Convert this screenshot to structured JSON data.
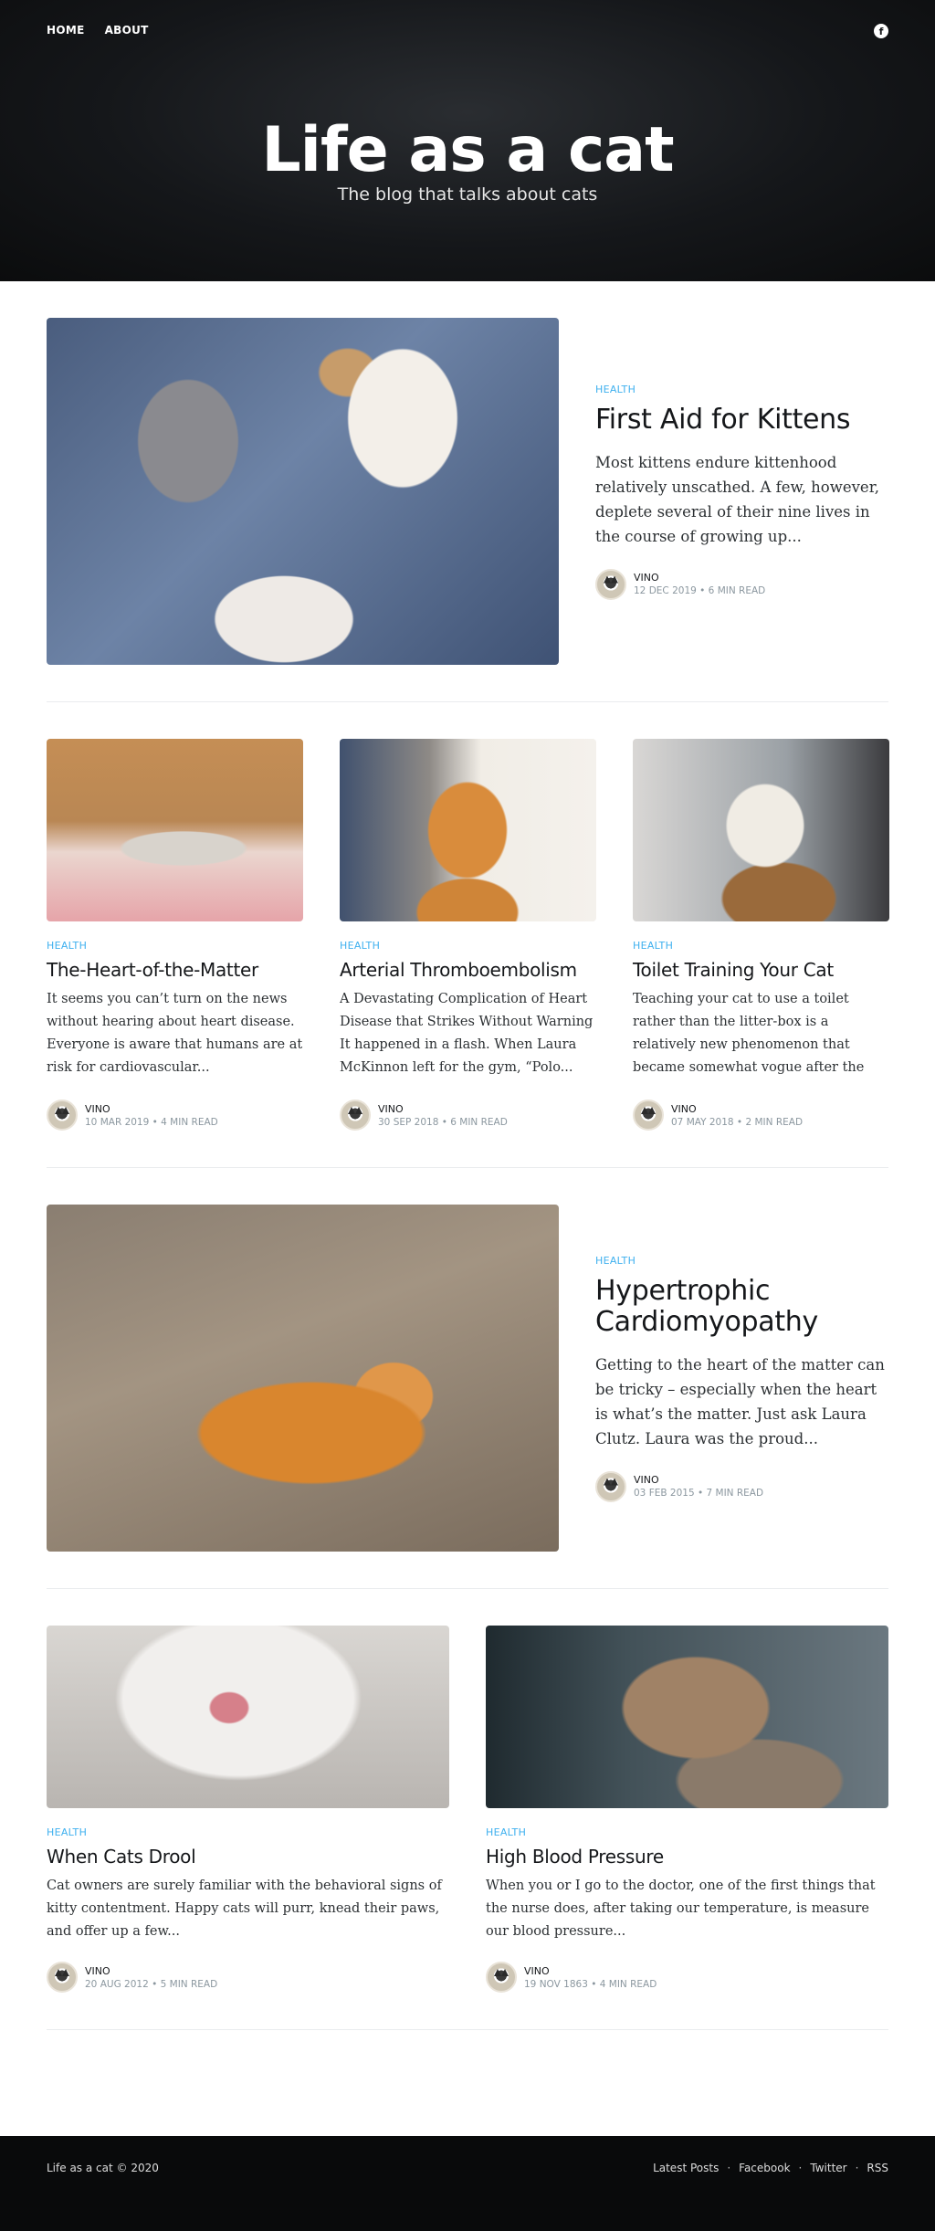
{
  "nav": {
    "home": "Home",
    "about": "About"
  },
  "site": {
    "title": "Life as a cat",
    "description": "The blog that talks about cats"
  },
  "posts": [
    {
      "tag": "Health",
      "title": "First Aid for Kittens",
      "excerpt": "Most kittens endure kittenhood relatively unscathed. A few, however, deplete several of their nine lives in the course of growing up...",
      "author": "Vino",
      "meta": "12 Dec 2019 • 6 min read"
    },
    {
      "tag": "Health",
      "title": "The-Heart-of-the-Matter",
      "excerpt": "It seems you can’t turn on the news without hearing about heart disease. Everyone is aware that humans are at risk for cardiovascular...",
      "author": "Vino",
      "meta": "10 Mar 2019 • 4 min read"
    },
    {
      "tag": "Health",
      "title": "Arterial Thromboembolism",
      "excerpt": "A Devastating Complication of Heart Disease that Strikes Without Warning It happened in a flash. When Laura McKinnon left for the gym, “Polo...",
      "author": "Vino",
      "meta": "30 Sep 2018 • 6 min read"
    },
    {
      "tag": "Health",
      "title": "Toilet Training Your Cat",
      "excerpt": "Teaching your cat to use a toilet rather than the litter-box is a relatively new phenomenon that became somewhat vogue after the movie “Meet...",
      "author": "Vino",
      "meta": "07 May 2018 • 2 min read"
    },
    {
      "tag": "Health",
      "title": "Hypertrophic Cardiomyopathy",
      "excerpt": "Getting to the heart of the matter can be tricky – especially when the heart is what’s the matter. Just ask Laura Clutz. Laura was the proud...",
      "author": "Vino",
      "meta": "03 Feb 2015 • 7 min read"
    },
    {
      "tag": "Health",
      "title": "When Cats Drool",
      "excerpt": "Cat owners are surely familiar with the behavioral signs of kitty contentment. Happy cats will purr, knead their paws, and offer up a few...",
      "author": "Vino",
      "meta": "20 Aug 2012 • 5 min read"
    },
    {
      "tag": "Health",
      "title": "High Blood Pressure",
      "excerpt": "When you or I go to the doctor, one of the first things that the nurse does, after taking our temperature, is measure our blood pressure...",
      "author": "Vino",
      "meta": "19 Nov 1863 • 4 min read"
    }
  ],
  "footer": {
    "copyright": "Life as a cat © 2020",
    "links": [
      "Latest Posts",
      "Facebook",
      "Twitter",
      "RSS"
    ]
  },
  "colors": {
    "accent": "#3eb0ef",
    "header_bg": "#15171a",
    "footer_bg": "#090a0b"
  },
  "icons": {
    "social": "facebook-icon"
  }
}
